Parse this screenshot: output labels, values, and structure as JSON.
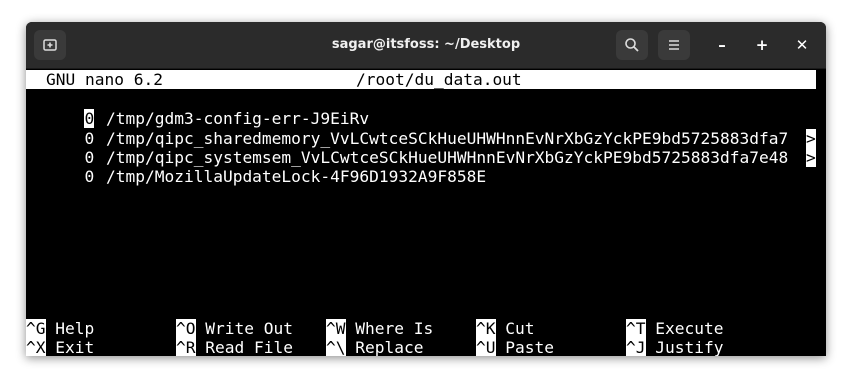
{
  "window": {
    "title": "sagar@itsfoss: ~/Desktop",
    "icons": {
      "new_tab": "new-tab-icon",
      "search": "search-icon",
      "menu": "hamburger-menu-icon",
      "minimize": "minimize-icon",
      "maximize": "maximize-icon",
      "close": "close-icon"
    },
    "controls": {
      "minimize": "–",
      "maximize": "+",
      "close": "✕"
    }
  },
  "nano": {
    "version": "GNU nano 6.2",
    "filename": "/root/du_data.out",
    "lines": [
      {
        "size": "0",
        "path": "/tmp/gdm3-config-err-J9EiRv",
        "overflow": ""
      },
      {
        "size": "0",
        "path": "/tmp/qipc_sharedmemory_VvLCwtceSCkHueUHWHnnEvNrXbGzYckPE9bd5725883dfa7",
        "overflow": ">"
      },
      {
        "size": "0",
        "path": "/tmp/qipc_systemsem_VvLCwtceSCkHueUHWHnnEvNrXbGzYckPE9bd5725883dfa7e48",
        "overflow": ">"
      },
      {
        "size": "0",
        "path": "/tmp/MozillaUpdateLock-4F96D1932A9F858E",
        "overflow": ""
      }
    ],
    "shortcuts_row1": [
      {
        "key": "^G",
        "label": "Help"
      },
      {
        "key": "^O",
        "label": "Write Out"
      },
      {
        "key": "^W",
        "label": "Where Is"
      },
      {
        "key": "^K",
        "label": "Cut"
      },
      {
        "key": "^T",
        "label": "Execute"
      }
    ],
    "shortcuts_row2": [
      {
        "key": "^X",
        "label": "Exit"
      },
      {
        "key": "^R",
        "label": "Read File"
      },
      {
        "key": "^\\",
        "label": "Replace"
      },
      {
        "key": "^U",
        "label": "Paste"
      },
      {
        "key": "^J",
        "label": "Justify"
      }
    ]
  },
  "colors": {
    "titlebar": "#2b2b2b",
    "terminal_bg": "#000000",
    "terminal_fg": "#ffffff"
  }
}
